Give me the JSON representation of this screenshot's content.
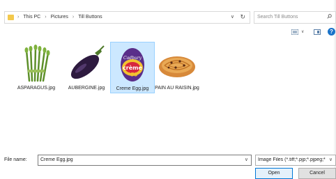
{
  "address": {
    "breadcrumbs": [
      "This PC",
      "Pictures",
      "Till Buttons"
    ],
    "separator": "›",
    "dropdown_glyph": "∨",
    "refresh_glyph": "↻"
  },
  "search": {
    "placeholder": "Search Till Buttons"
  },
  "toolbar": {
    "view_icon": "view-list-icon",
    "pane_icon": "preview-pane-icon",
    "help_glyph": "?"
  },
  "files": [
    {
      "name": "ASPARAGUS.jpg",
      "icon": "asparagus-thumbnail",
      "selected": false
    },
    {
      "name": "AUBERGINE.jpg",
      "icon": "aubergine-thumbnail",
      "selected": false
    },
    {
      "name": "Creme Egg.jpg",
      "icon": "creme-egg-thumbnail",
      "selected": true
    },
    {
      "name": "PAIN AU RAISIN.jpg",
      "icon": "pain-au-raisin-thumbnail",
      "selected": false
    }
  ],
  "file_name": {
    "label": "File name:",
    "value": "Creme Egg.jpg",
    "dropdown_glyph": "∨"
  },
  "file_type": {
    "value": "Image Files (*.tiff;*.pjp;*.pjpeg;*",
    "dropdown_glyph": "∨"
  },
  "buttons": {
    "open": "Open",
    "cancel": "Cancel"
  },
  "colors": {
    "selection": "#cce8ff",
    "selection_border": "#99d1ff",
    "accent": "#0078d7"
  }
}
